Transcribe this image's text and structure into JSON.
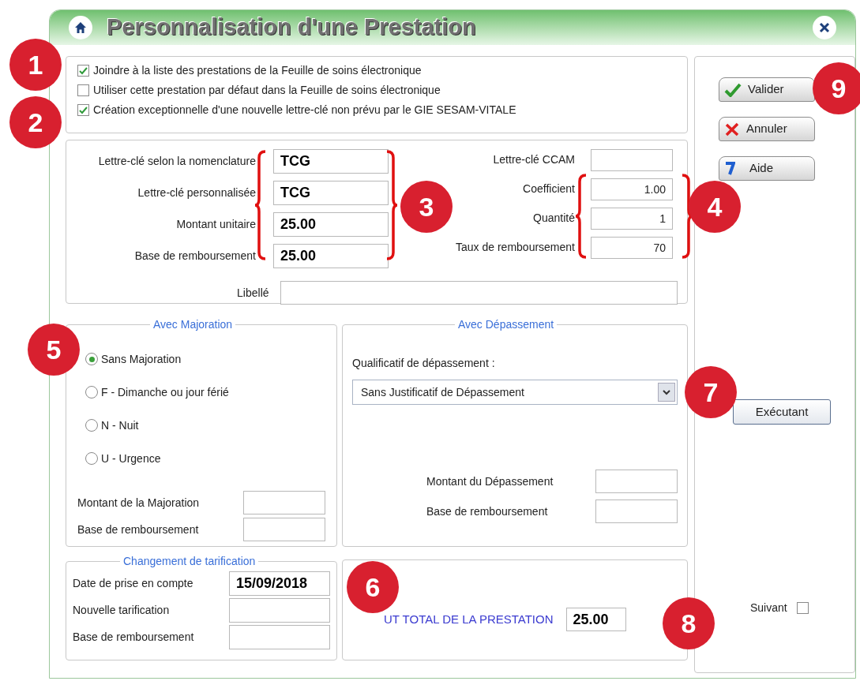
{
  "window": {
    "title": "Personnalisation d'une Prestation"
  },
  "options": [
    {
      "label": "Joindre à la liste des prestations de la Feuille de soins électronique",
      "checked": true
    },
    {
      "label": "Utiliser cette prestation par défaut dans la Feuille de soins électronique",
      "checked": false
    },
    {
      "label": "Création exceptionnelle d'une nouvelle lettre-clé non prévu par le GIE SESAM-VITALE",
      "checked": true
    }
  ],
  "key_fields": {
    "left": [
      {
        "label": "Lettre-clé selon la nomenclature",
        "value": "TCG"
      },
      {
        "label": "Lettre-clé personnalisée",
        "value": "TCG"
      },
      {
        "label": "Montant unitaire",
        "value": "25.00"
      },
      {
        "label": "Base de remboursement",
        "value": "25.00"
      }
    ],
    "right": [
      {
        "label": "Lettre-clé CCAM"
      },
      {
        "label": "Coefficient",
        "value": "1.00"
      },
      {
        "label": "Quantité",
        "value": "1"
      },
      {
        "label": "Taux de remboursement",
        "value": "70"
      }
    ],
    "libelle": {
      "label": "Libellé"
    }
  },
  "majoration": {
    "title": "Avec Majoration",
    "options": [
      {
        "label": "Sans Majoration",
        "selected": true
      },
      {
        "label": "F - Dimanche ou jour férié",
        "selected": false
      },
      {
        "label": "N - Nuit",
        "selected": false
      },
      {
        "label": "U - Urgence",
        "selected": false
      }
    ],
    "fields": [
      {
        "label": "Montant de la Majoration"
      },
      {
        "label": "Base de remboursement"
      }
    ]
  },
  "depassement": {
    "title": "Avec Dépassement",
    "qualifier_label": "Qualificatif de dépassement :",
    "qualifier_value": "Sans Justificatif de Dépassement",
    "fields": [
      {
        "label": "Montant du Dépassement"
      },
      {
        "label": "Base de remboursement"
      }
    ]
  },
  "tarification": {
    "title": "Changement de tarification",
    "fields": [
      {
        "label": "Date de prise en compte",
        "value": "15/09/2018"
      },
      {
        "label": "Nouvelle tarification"
      },
      {
        "label": "Base de remboursement"
      }
    ]
  },
  "total": {
    "label": "UT TOTAL DE LA PRESTATION",
    "value": "25.00"
  },
  "actions": [
    {
      "label": "Valider",
      "kind": "validate"
    },
    {
      "label": "Annuler",
      "kind": "cancel"
    },
    {
      "label": "Aide",
      "kind": "help"
    }
  ],
  "executant": {
    "label": "Exécutant"
  },
  "next": {
    "label": "Suivant",
    "checked": false
  },
  "callouts": [
    "1",
    "2",
    "3",
    "4",
    "5",
    "6",
    "7",
    "8",
    "9"
  ]
}
